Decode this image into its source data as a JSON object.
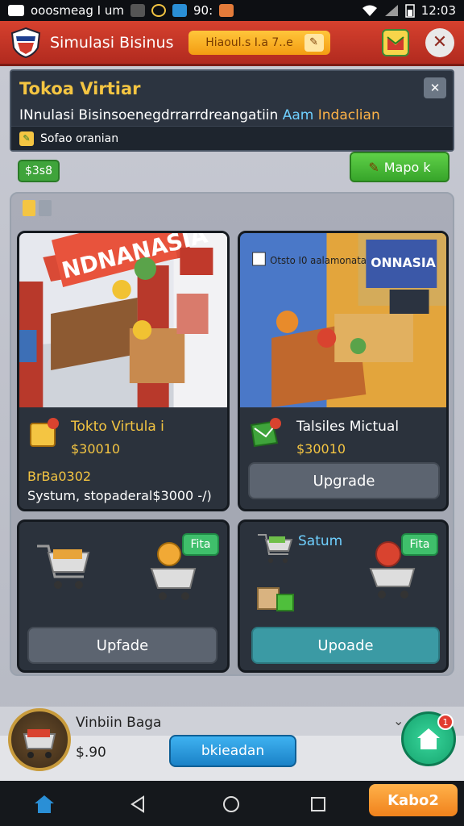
{
  "status_bar": {
    "carrier": "ooosmeag I um",
    "indicator": "90:",
    "time": "12:03"
  },
  "header": {
    "title": "Simulasi Bisinus",
    "pill_label": "Hiaoul.s I.a 7..e",
    "icons": [
      "shield-logo",
      "pencil-icon",
      "gift-icon",
      "close-icon"
    ]
  },
  "info_card": {
    "title": "Tokoa Virtiar",
    "subtitle_main": "INnulasi Bisinsoenegdrrarrdreangatiin",
    "subtitle_hl1": "Aam",
    "subtitle_hl2": "Indaclian",
    "footer_text": "Sofao oranian"
  },
  "money_badge": "$3s8",
  "mode_button": "Mapo  k",
  "cards": [
    {
      "sign": "NDNANASIA",
      "name": "Tokto Virtula i",
      "price": "$30010",
      "subprice": "BrBa0302",
      "detail": "Systum, stopaderal‏/- $3000)"
    },
    {
      "sign": "ONNASIA",
      "overlay": "Otsto I0 aalamonata",
      "name": "Talsiles Mictual",
      "price": "$30010",
      "button": "Upgrade"
    },
    {
      "tag": "Fita",
      "button": "Upfade"
    },
    {
      "label": "Satum",
      "tag": "Fita",
      "button": "Upoade"
    }
  ],
  "bottom": {
    "name": "Vinbiin Baga",
    "amount": "$.90",
    "button": "bkieadan",
    "fab_badge": "1"
  },
  "nav": {
    "action": "Kabo2"
  },
  "colors": {
    "header_red": "#c93324",
    "accent_gold": "#f4c542",
    "button_green": "#3fa43b",
    "button_teal": "#3b9aa4",
    "button_blue": "#1b82c7",
    "button_orange": "#f0821c"
  }
}
